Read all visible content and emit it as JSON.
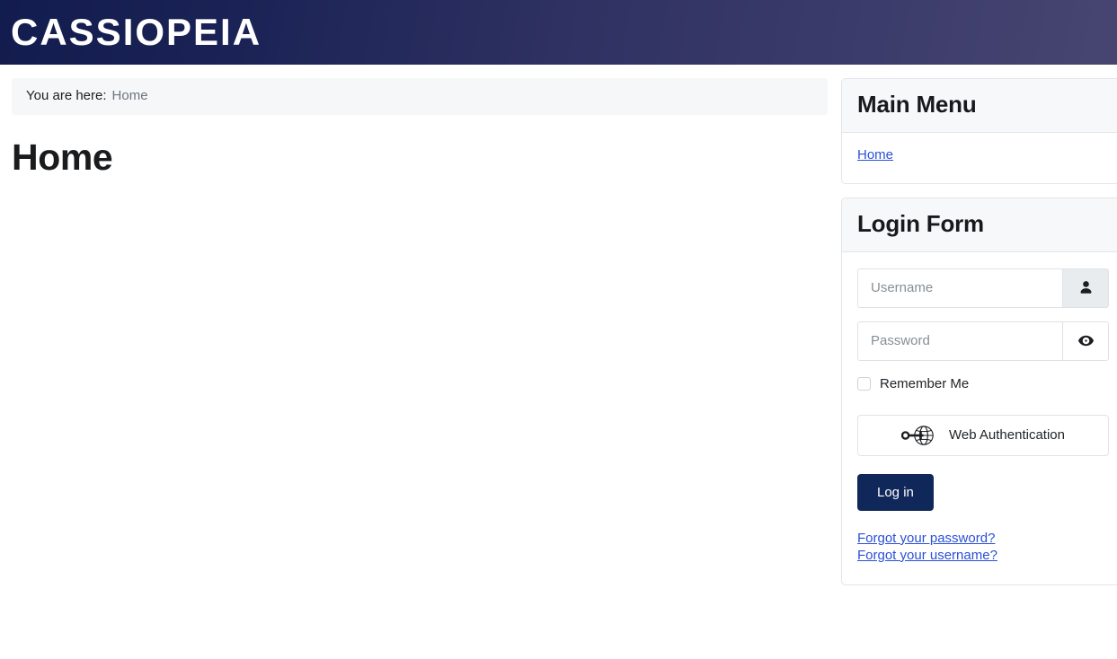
{
  "header": {
    "brand": "CASSIOPEIA",
    "gradient_from": "#131c4e",
    "gradient_to": "#474570"
  },
  "breadcrumb": {
    "label": "You are here:",
    "current": "Home"
  },
  "main": {
    "page_title": "Home"
  },
  "sidebar": {
    "modules": [
      {
        "title": "Main Menu",
        "items": [
          {
            "label": "Home",
            "icon": ""
          }
        ]
      },
      {
        "title": "Login Form"
      }
    ]
  },
  "login_form": {
    "title": "Login Form",
    "username": {
      "value": "",
      "placeholder": "Username",
      "addon_icon": "user-icon"
    },
    "password": {
      "value": "",
      "placeholder": "Password",
      "addon_icon": "eye-icon"
    },
    "remember_me": {
      "label": "Remember Me",
      "checked": false
    },
    "webauthn_button": {
      "label": "Web Authentication",
      "icon": "webauthn-key-globe-icon"
    },
    "submit_button": {
      "label": "Log in",
      "color": "#10275a"
    },
    "links": [
      {
        "label": "Forgot your password?"
      },
      {
        "label": "Forgot your username?"
      }
    ]
  },
  "colors": {
    "link": "#2a50d6",
    "card_border": "#e3e5e8",
    "card_header_bg": "#f7f8f9",
    "breadcrumb_bg": "#f6f7f8",
    "addon_shaded_bg": "#e9ecef"
  }
}
